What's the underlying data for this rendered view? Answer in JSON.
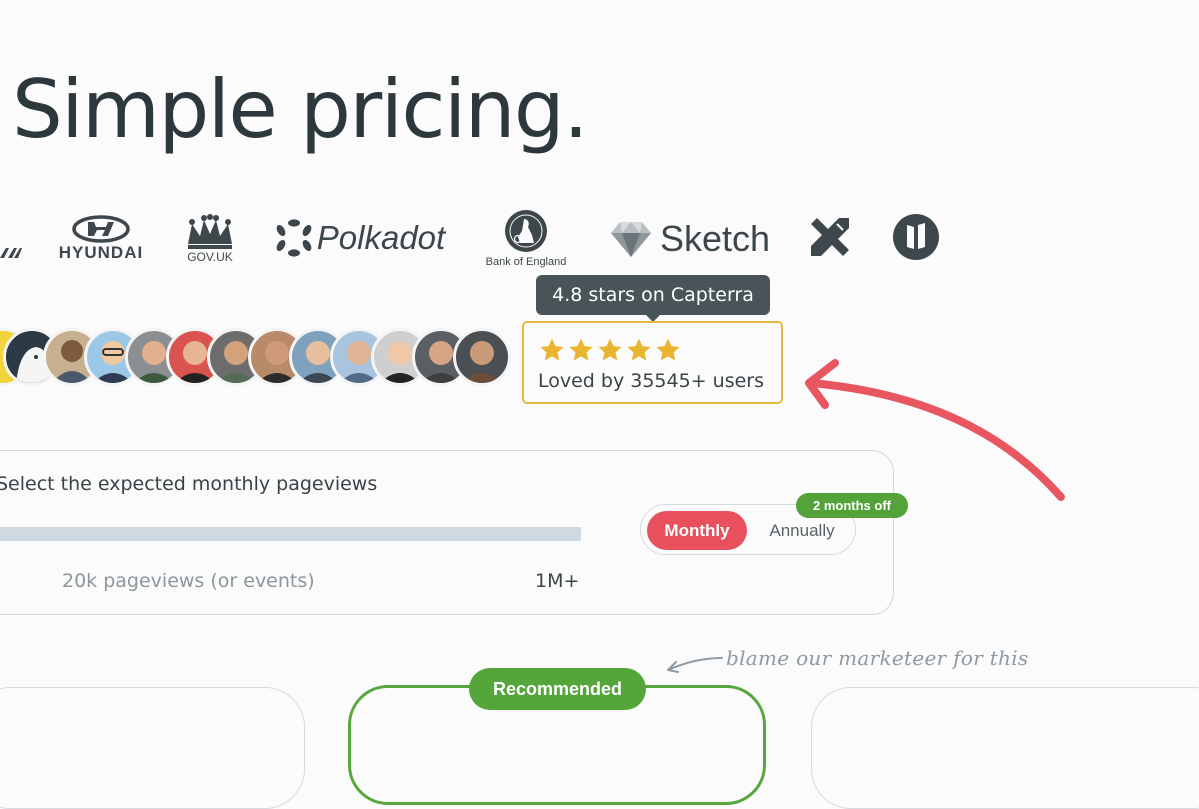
{
  "headline": "Simple pricing.",
  "logos": {
    "hyundai": "HYUNDAI",
    "govuk": "GOV.UK",
    "polkadot": "Polkadot",
    "bank_of_england": "Bank of England",
    "sketch": "Sketch"
  },
  "rating": {
    "tooltip": "4.8 stars on Capterra",
    "stars": 5,
    "label": "Loved by 35545+ users",
    "star_color": "#e9b52f"
  },
  "pageviews": {
    "label": "Select the expected monthly pageviews",
    "value_label": "20k pageviews (or events)",
    "max_label": "1M+"
  },
  "billing": {
    "monthly": "Monthly",
    "annually": "Annually",
    "discount_badge": "2 months off",
    "accent": "#e8505e"
  },
  "plans": {
    "recommended_badge": "Recommended"
  },
  "annotation": "blame our marketeer for this"
}
